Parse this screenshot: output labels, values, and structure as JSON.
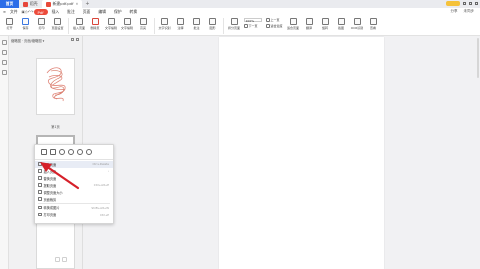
{
  "titlebar": {
    "home": "首页",
    "tabs": [
      {
        "label": "稻壳"
      },
      {
        "label": "新建pdf.pdf"
      }
    ]
  },
  "menubar": {
    "items": [
      "文件",
      "Pdf",
      "插入",
      "批注",
      "页面",
      "编辑",
      "保护",
      "转换"
    ],
    "active_index": 1,
    "right": [
      "分享",
      "未同步"
    ]
  },
  "ribbon": {
    "buttons": [
      "打开",
      "保存",
      "打印",
      "页面设置",
      "插入页面",
      "删除页",
      "文字编辑",
      "文字编辑",
      "高亮",
      "文字识别",
      "注释",
      "批注",
      "图形",
      "拆分页面",
      "适合页面",
      "翻译",
      "旋转",
      "截图",
      "OCR识别",
      "查看"
    ],
    "zoom": "100%",
    "small_rows": [
      "下一页",
      "上一页",
      "适合宽度"
    ]
  },
  "thumb_panel": {
    "header": "缩略图 · 页面/缩略图 ▾",
    "page1_label": "第1页"
  },
  "context_menu": {
    "items": [
      {
        "label": "删除页面",
        "shortcut": "Ctrl+Delete",
        "hover": true
      },
      {
        "label": "插入页面",
        "shortcut": "›"
      },
      {
        "label": "替换页面",
        "shortcut": ""
      },
      {
        "label": "提取页面",
        "shortcut": "Ctrl+Alt+E"
      },
      {
        "label": "调整页面大小",
        "shortcut": ""
      },
      {
        "label": "页面裁剪",
        "shortcut": ""
      },
      {
        "label": "转换成图片",
        "shortcut": "Shift+Alt+W"
      },
      {
        "label": "打印页面",
        "shortcut": "Ctrl+P"
      }
    ]
  },
  "colors": {
    "accent": "#2b6de8",
    "pdf_tab": "#ec4b3b",
    "arrow": "#d6202a"
  }
}
